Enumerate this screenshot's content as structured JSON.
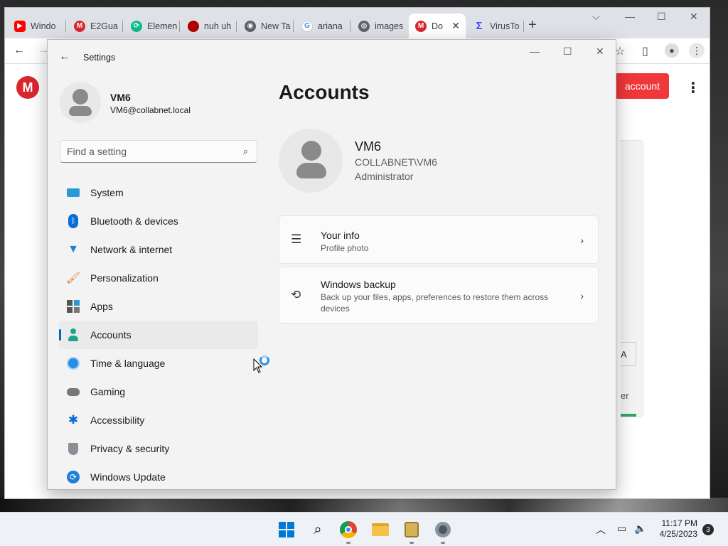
{
  "browser": {
    "tabs": [
      {
        "label": "Windo",
        "icon": "youtube-icon",
        "color": "#ff0000"
      },
      {
        "label": "E2Gua",
        "icon": "mega-icon",
        "color": "#d9272e"
      },
      {
        "label": "Elemen",
        "icon": "element-icon",
        "color": "#0dbd8b"
      },
      {
        "label": "nuh uh",
        "icon": "red-circle-icon",
        "color": "#b00000"
      },
      {
        "label": "New Ta",
        "icon": "chrome-icon",
        "color": "#5f6368"
      },
      {
        "label": "ariana",
        "icon": "google-icon",
        "color": "#4285f4"
      },
      {
        "label": "images",
        "icon": "globe-icon",
        "color": "#5f6368"
      },
      {
        "label": "Do",
        "icon": "mega-icon",
        "color": "#d9272e"
      },
      {
        "label": "VirusTo",
        "icon": "virustotal-icon",
        "color": "#394eff"
      }
    ],
    "page": {
      "create_account_button": "account"
    },
    "background_fragments": {
      "button_text": "A",
      "text": "er"
    }
  },
  "settings": {
    "window_title": "Settings",
    "user": {
      "name": "VM6",
      "email": "VM6@collabnet.local"
    },
    "search_placeholder": "Find a setting",
    "nav": [
      {
        "label": "System",
        "icon": "system-icon",
        "active": false
      },
      {
        "label": "Bluetooth & devices",
        "icon": "bluetooth-icon",
        "active": false
      },
      {
        "label": "Network & internet",
        "icon": "wifi-icon",
        "active": false
      },
      {
        "label": "Personalization",
        "icon": "brush-icon",
        "active": false
      },
      {
        "label": "Apps",
        "icon": "apps-icon",
        "active": false
      },
      {
        "label": "Accounts",
        "icon": "accounts-icon",
        "active": true
      },
      {
        "label": "Time & language",
        "icon": "globe-clock-icon",
        "active": false
      },
      {
        "label": "Gaming",
        "icon": "gamepad-icon",
        "active": false
      },
      {
        "label": "Accessibility",
        "icon": "accessibility-icon",
        "active": false
      },
      {
        "label": "Privacy & security",
        "icon": "shield-icon",
        "active": false
      },
      {
        "label": "Windows Update",
        "icon": "update-icon",
        "active": false
      }
    ],
    "page_title": "Accounts",
    "account": {
      "name": "VM6",
      "domain": "COLLABNET\\VM6",
      "role": "Administrator"
    },
    "cards": [
      {
        "title": "Your info",
        "subtitle": "Profile photo",
        "icon": "person-list-icon"
      },
      {
        "title": "Windows backup",
        "subtitle": "Back up your files, apps, preferences to restore them across devices",
        "icon": "backup-icon"
      }
    ]
  },
  "taskbar": {
    "time": "11:17 PM",
    "date": "4/25/2023",
    "notifications": "3"
  },
  "colors": {
    "accent": "#0067c0",
    "mega_red": "#f0373a"
  }
}
